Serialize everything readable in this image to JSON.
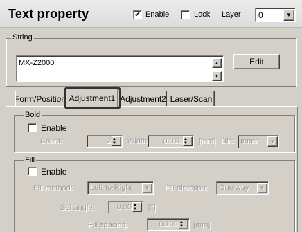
{
  "header": {
    "title": "Text property",
    "enable_label": "Enable",
    "enable_checked": true,
    "lock_label": "Lock",
    "lock_checked": false,
    "layer_label": "Layer",
    "layer_value": "0"
  },
  "string_group": {
    "title": "String",
    "value": "MX-Z2000",
    "edit_button": "Edit"
  },
  "tabs": [
    {
      "label": "Form/Position",
      "active": false
    },
    {
      "label": "Adjustment1",
      "active": true
    },
    {
      "label": "Adjustment2",
      "active": false
    },
    {
      "label": "Laser/Scan",
      "active": false
    }
  ],
  "bold": {
    "title": "Bold",
    "enable_label": "Enable",
    "count_label": "Count:",
    "count_value": "2",
    "width_label": "Width:",
    "width_value": "0.010",
    "width_unit": "[mm]",
    "dir_label": "Dir.:",
    "dir_value": "Inner"
  },
  "fill": {
    "title": "Fill",
    "enable_label": "Enable",
    "method_label": "Fill method:",
    "method_value": "Left-to-Right",
    "direction_label": "Fill direction:",
    "direction_value": "One way",
    "angle_label": "Set angle:",
    "angle_value": "0.00",
    "angle_unit": "[°]",
    "spacing_label": "Fill spacing:",
    "spacing_value": "0.100",
    "spacing_unit": "[mm]"
  },
  "icons": {
    "dropdown": "chevron-down-icon",
    "spin": "spin-up-down-icon",
    "scroll_up": "scroll-up-arrow-icon",
    "scroll_down": "scroll-down-arrow-icon",
    "check": "checkmark-icon"
  }
}
